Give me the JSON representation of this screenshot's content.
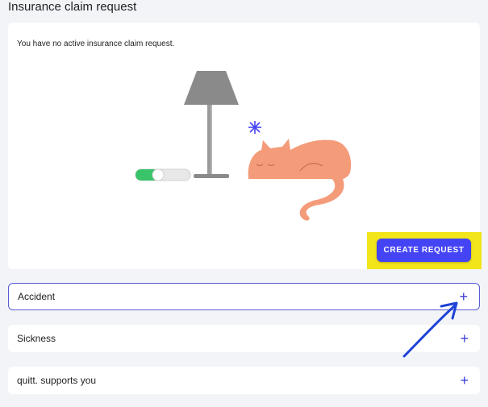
{
  "page": {
    "title": "Insurance claim request"
  },
  "claim_card": {
    "empty_message": "You have no active insurance claim request.",
    "create_button_label": "CREATE REQUEST"
  },
  "accordions": [
    {
      "label": "Accident",
      "expand_icon": "plus-icon",
      "state": "focused"
    },
    {
      "label": "Sickness",
      "expand_icon": "plus-icon",
      "state": "collapsed"
    },
    {
      "label": "quitt. supports you",
      "expand_icon": "plus-icon",
      "state": "collapsed"
    }
  ],
  "plus_glyph": "+",
  "colors": {
    "accent": "#4444f5",
    "highlight": "#f2e51a",
    "annotation_arrow": "#1f43d6",
    "cat": "#f49b7a",
    "lamp": "#8a8a8a",
    "toggle_on": "#39c46a"
  }
}
